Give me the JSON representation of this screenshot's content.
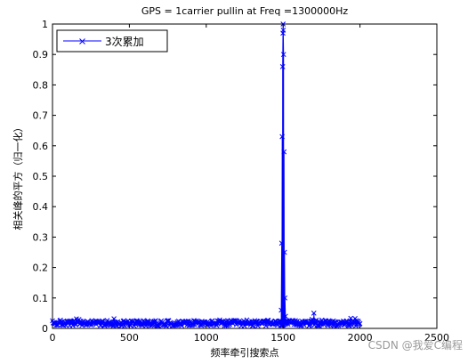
{
  "chart_data": {
    "type": "line",
    "title": "GPS = 1carrier pullin at    Freq =1300000Hz",
    "xlabel": "频率牵引搜索点",
    "ylabel": "相关峰的平方（归一化）",
    "xlim": [
      0,
      2500
    ],
    "ylim": [
      0,
      1
    ],
    "x_ticks": [
      "0",
      "500",
      "1000",
      "1500",
      "2000",
      "2500"
    ],
    "y_ticks": [
      "0",
      "0.1",
      "0.2",
      "0.3",
      "0.4",
      "0.5",
      "0.6",
      "0.7",
      "0.8",
      "0.9",
      "1"
    ],
    "grid": false,
    "legend_position": "top-left",
    "series": [
      {
        "name": "3次累加",
        "color": "#0000ff",
        "marker": "x",
        "x_range": [
          0,
          2000
        ],
        "noise_floor": 0.02,
        "peaks": [
          {
            "x": 1484,
            "y": 0.01
          },
          {
            "x": 1488,
            "y": 0.06
          },
          {
            "x": 1491,
            "y": 0.28
          },
          {
            "x": 1494,
            "y": 0.63
          },
          {
            "x": 1497,
            "y": 0.86
          },
          {
            "x": 1499,
            "y": 0.97
          },
          {
            "x": 1500,
            "y": 1.0
          },
          {
            "x": 1501,
            "y": 0.98
          },
          {
            "x": 1503,
            "y": 0.9
          },
          {
            "x": 1506,
            "y": 0.58
          },
          {
            "x": 1509,
            "y": 0.25
          },
          {
            "x": 1512,
            "y": 0.1
          },
          {
            "x": 1516,
            "y": 0.04
          },
          {
            "x": 1700,
            "y": 0.05
          }
        ]
      }
    ]
  },
  "watermark": "CSDN @我爱C编程"
}
